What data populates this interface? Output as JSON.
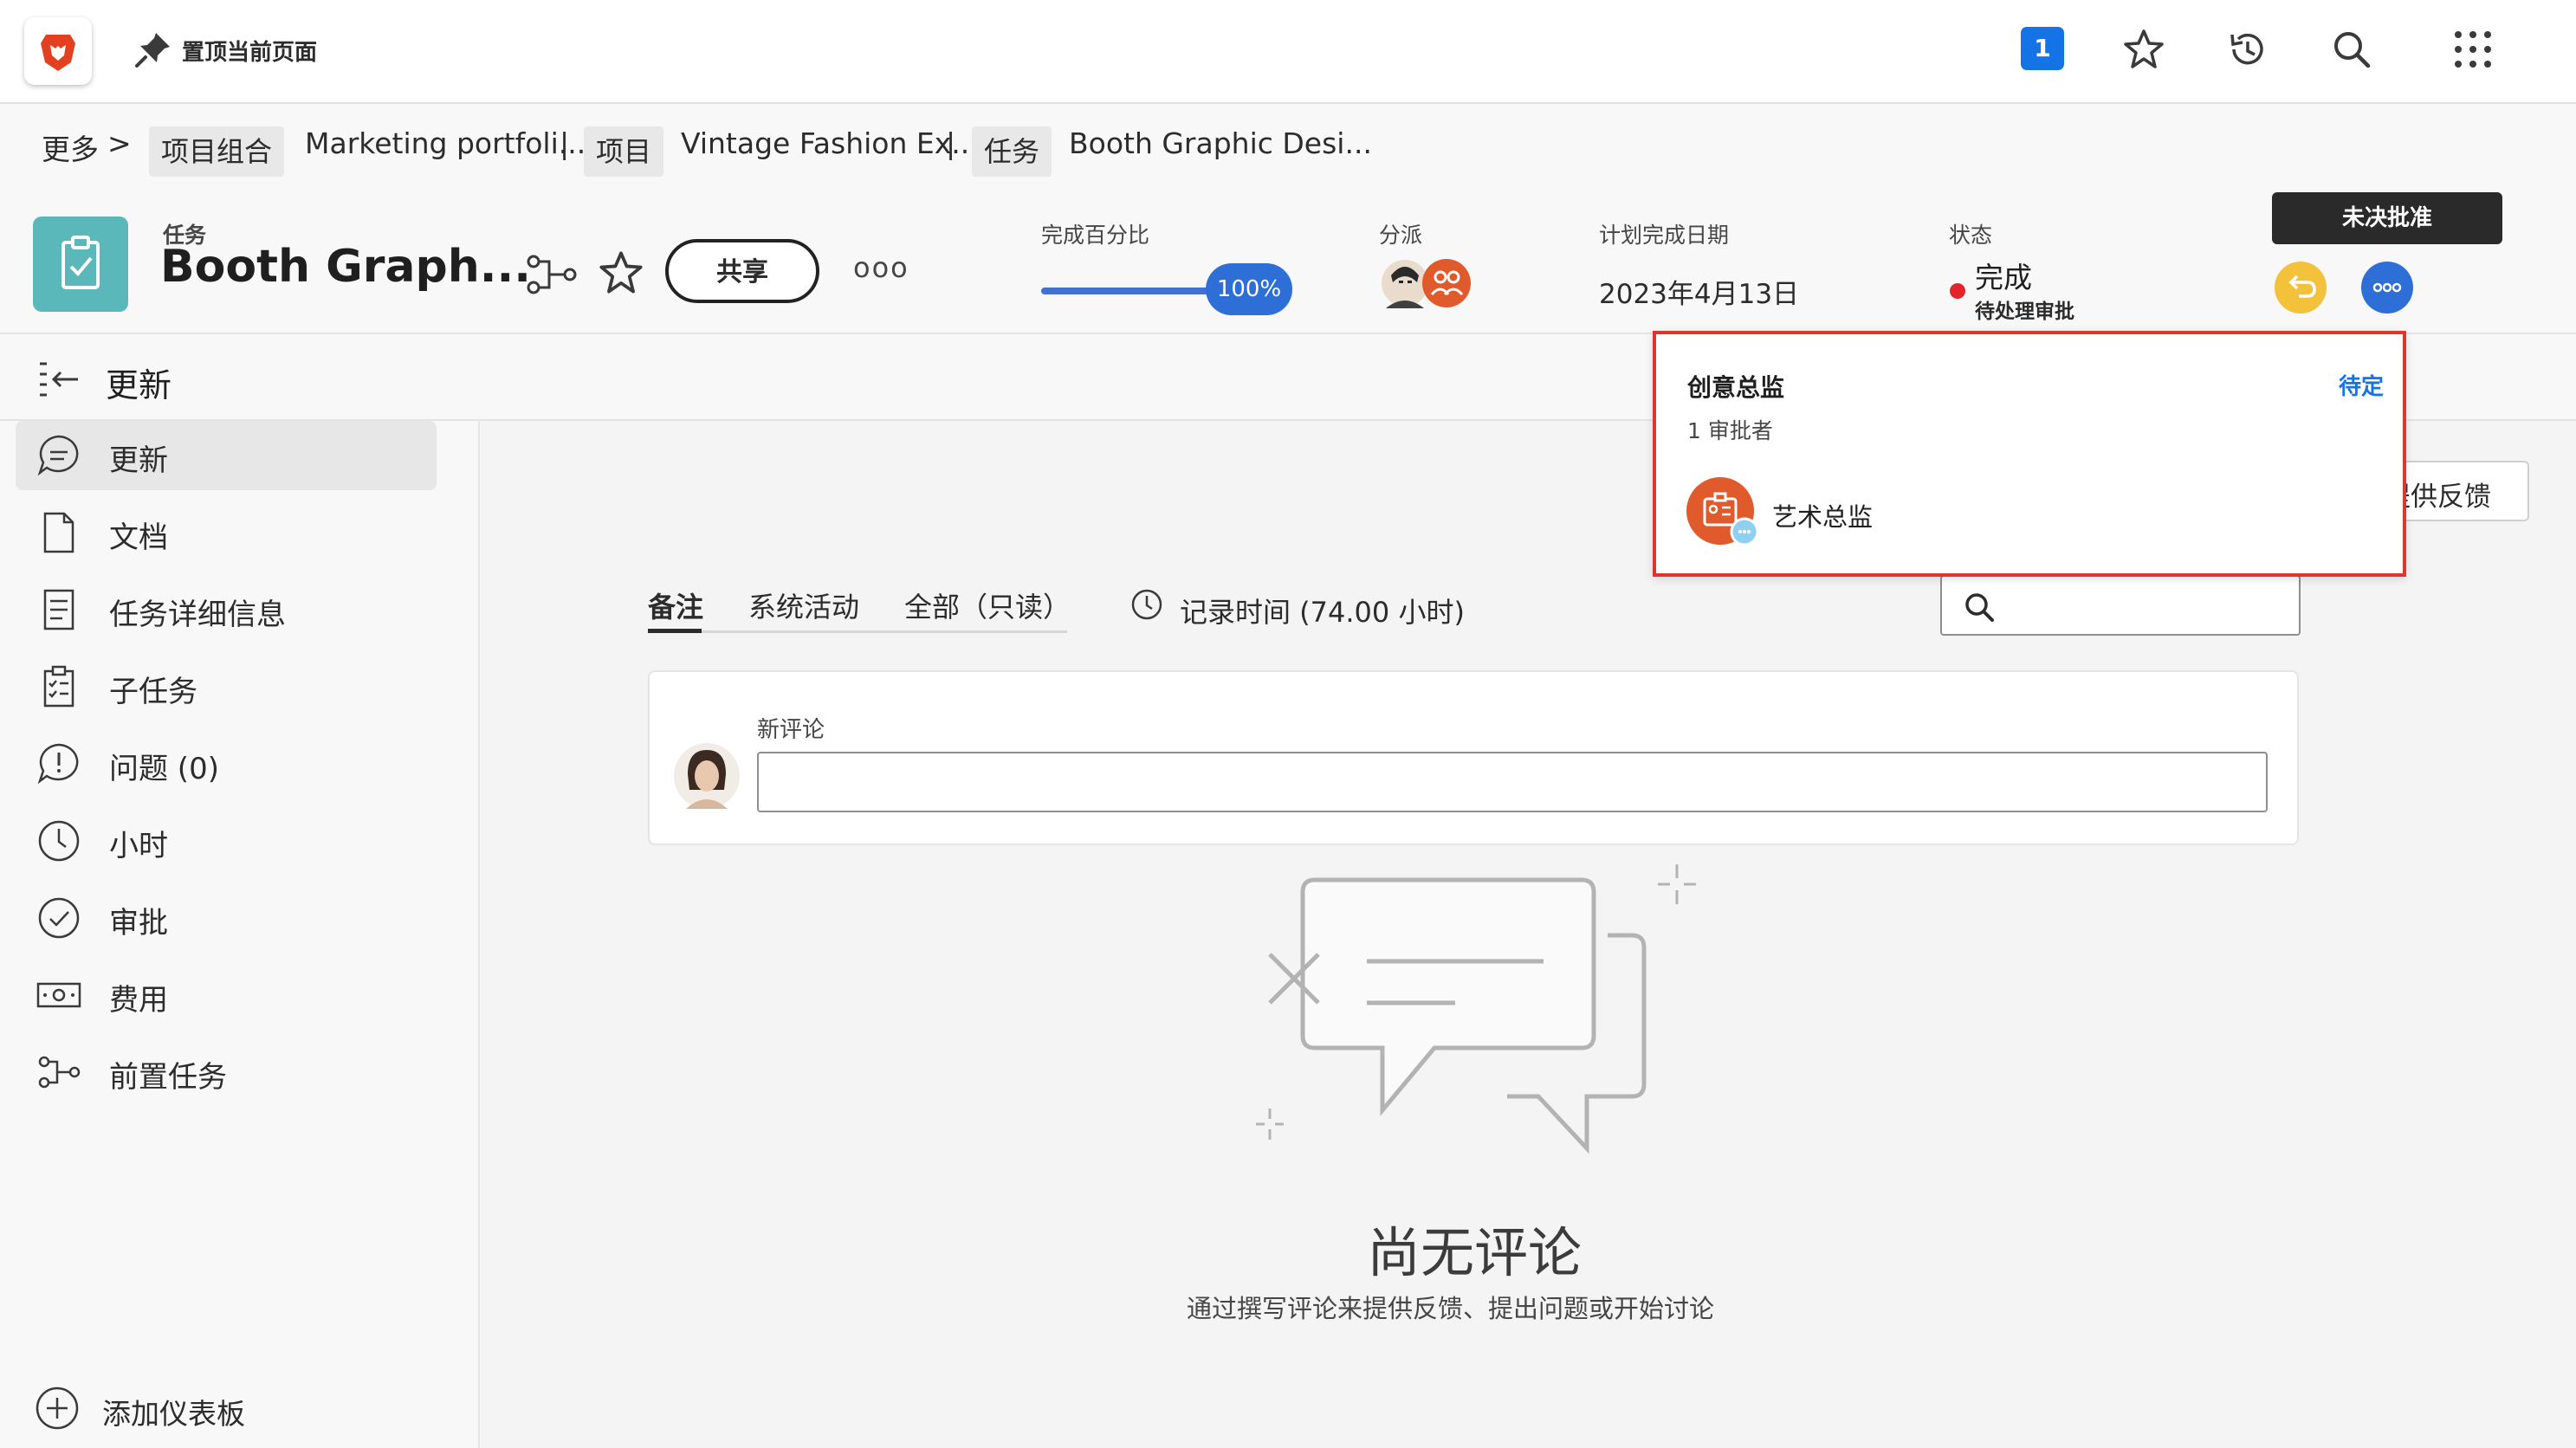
{
  "topbar": {
    "pin_label": "置顶当前页面",
    "notification_count": "1"
  },
  "breadcrumb": {
    "more": "更多",
    "sep": ">",
    "portfolio_tag": "项目组合",
    "portfolio_name": "Marketing portfoli...",
    "divider": "|",
    "project_tag": "项目",
    "project_name": "Vintage Fashion Ex...",
    "task_tag": "任务",
    "task_name": "Booth Graphic Desi..."
  },
  "header": {
    "type_label": "任务",
    "title": "Booth Graph...",
    "share_label": "共享",
    "more_glyph": "ooo",
    "percent_label": "完成百分比",
    "percent_value": "100%",
    "assign_label": "分派",
    "due_label": "计划完成日期",
    "due_value": "2023年4月13日",
    "status_label": "状态",
    "status_value": "完成",
    "status_sub": "待处理审批",
    "unapproved_label": "未决批准"
  },
  "progress": {
    "fraction": 1.0
  },
  "approval_popup": {
    "title": "创意总监",
    "status": "待定",
    "count": "1 审批者",
    "approver": "艺术总监"
  },
  "sidebar": {
    "heading": "更新",
    "items": [
      {
        "label": "更新"
      },
      {
        "label": "文档"
      },
      {
        "label": "任务详细信息"
      },
      {
        "label": "子任务"
      },
      {
        "label": "问题 (0)"
      },
      {
        "label": "小时"
      },
      {
        "label": "审批"
      },
      {
        "label": "费用"
      },
      {
        "label": "前置任务"
      }
    ],
    "add_dashboard": "添加仪表板"
  },
  "main": {
    "feedback_label": "提供反馈",
    "tabs": [
      {
        "label": "备注"
      },
      {
        "label": "系统活动"
      },
      {
        "label": "全部（只读）"
      }
    ],
    "logged_time": "记录时间 (74.00 小时)",
    "new_comment_label": "新评论",
    "empty_title": "尚无评论",
    "empty_sub": "通过撰写评论来提供反馈、提出问题或开始讨论"
  },
  "colors": {
    "accent_blue": "#1473e6",
    "task_teal": "#5bb8ba",
    "status_red": "#e3242b",
    "approve_yellow": "#f3c13a",
    "popup_border": "#e0342e"
  }
}
